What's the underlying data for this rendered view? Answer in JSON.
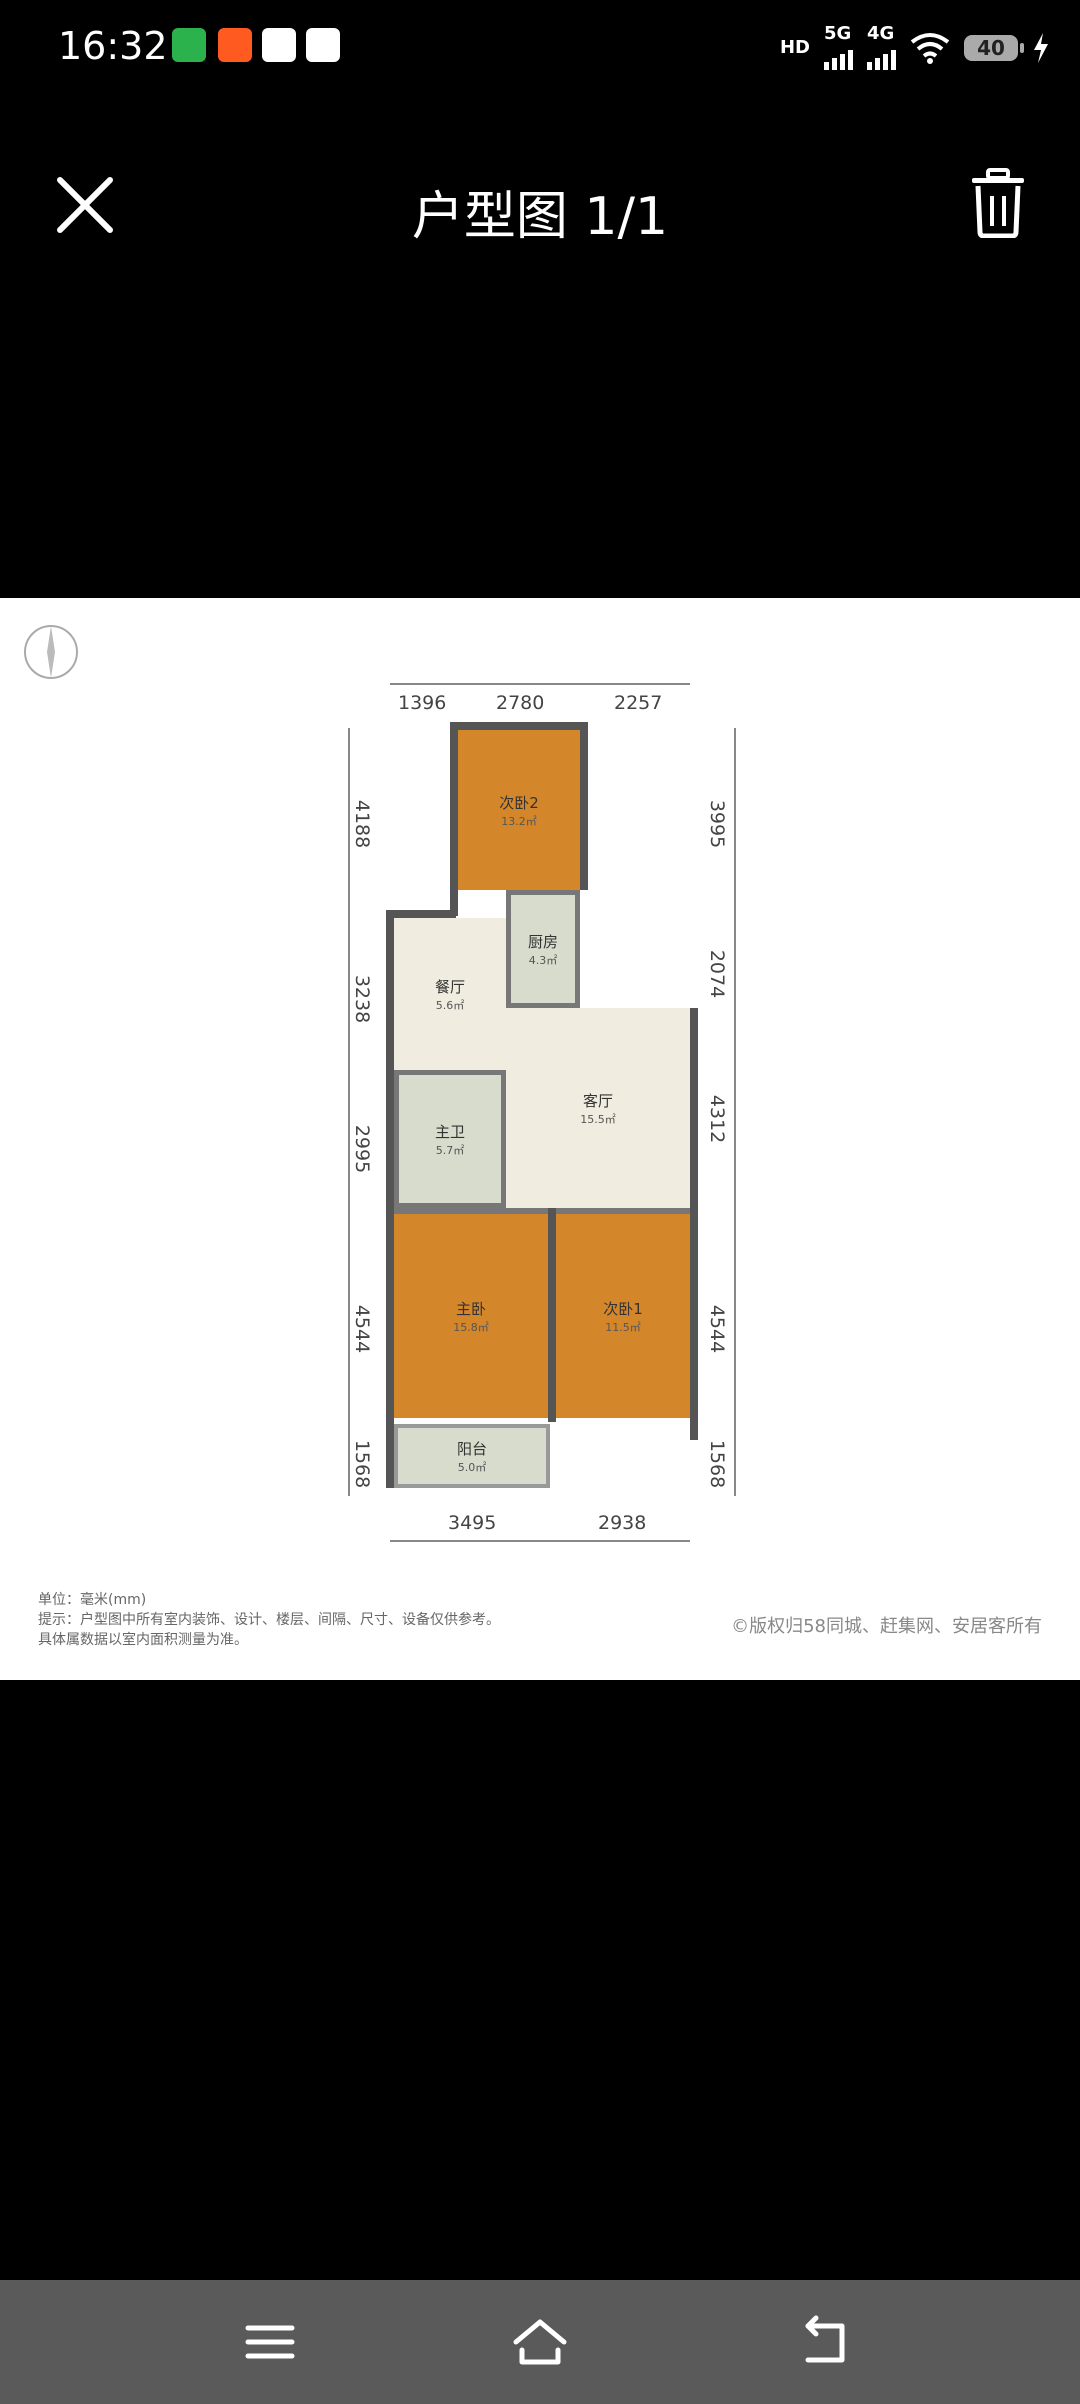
{
  "status_bar": {
    "time": "16:32",
    "notification_icons": [
      "video-app-icon",
      "music-app-icon",
      "tiktok-icon",
      "baidu-icon"
    ],
    "hd_label": "HD",
    "network_1": "5G",
    "network_2": "4G",
    "battery_level": "40"
  },
  "header": {
    "title": "户型图 1/1",
    "close_icon": "close-icon",
    "delete_icon": "trash-icon"
  },
  "floor_plan": {
    "dims_top": [
      "1396",
      "2780",
      "2257"
    ],
    "dims_bottom": [
      "3495",
      "2938"
    ],
    "dims_left": [
      "4188",
      "3238",
      "2995",
      "4544",
      "1568"
    ],
    "dims_right": [
      "3995",
      "2074",
      "4312",
      "4544",
      "1568"
    ],
    "rooms": {
      "bedroom2": {
        "name": "次卧2",
        "area": "13.2㎡"
      },
      "kitchen": {
        "name": "厨房",
        "area": "4.3㎡"
      },
      "dining": {
        "name": "餐厅",
        "area": "5.6㎡"
      },
      "living": {
        "name": "客厅",
        "area": "15.5㎡"
      },
      "bath": {
        "name": "主卫",
        "area": "5.7㎡"
      },
      "master": {
        "name": "主卧",
        "area": "15.8㎡"
      },
      "bedroom1": {
        "name": "次卧1",
        "area": "11.5㎡"
      },
      "balcony": {
        "name": "阳台",
        "area": "5.0㎡"
      }
    },
    "notes": [
      "单位：毫米(mm)",
      "提示：户型图中所有室内装饰、设计、楼层、间隔、尺寸、设备仅供参考。",
      "具体属数据以室内面积测量为准。"
    ],
    "copyright": "©版权归58同城、赶集网、安居客所有"
  },
  "nav": {
    "menu_icon": "menu-icon",
    "home_icon": "home-icon",
    "back_icon": "back-icon"
  },
  "colors": {
    "bedroom": "#d4862b",
    "floor": "#f0ecdf",
    "wet": "#d8dccc",
    "wall": "#555555"
  }
}
